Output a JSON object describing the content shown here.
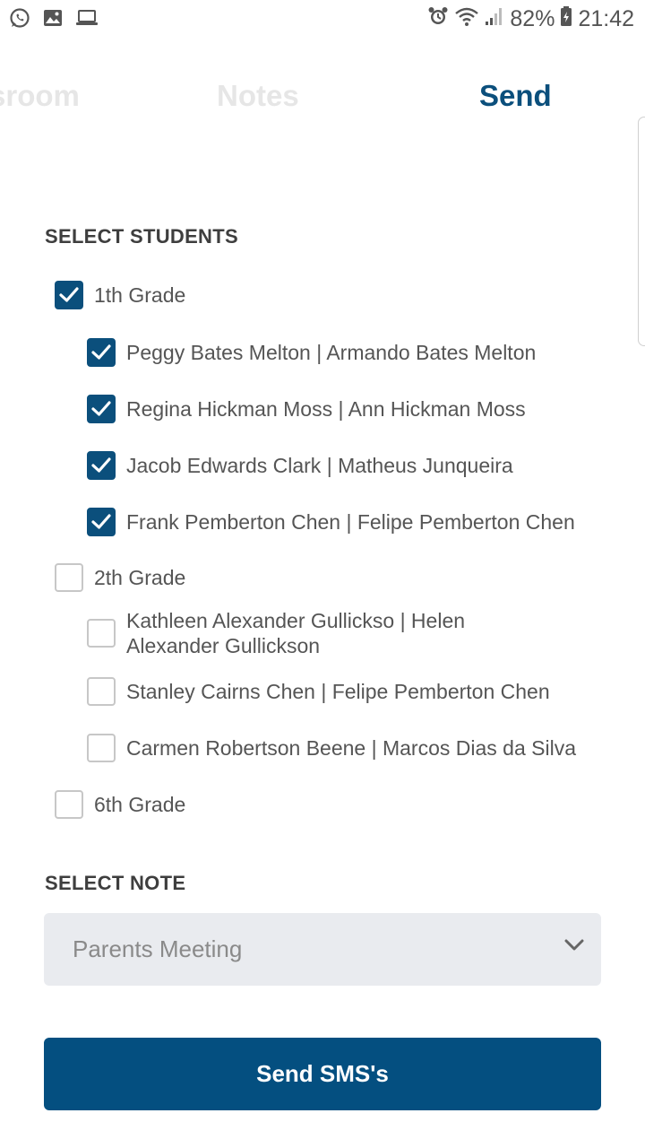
{
  "status_bar": {
    "left_icons": [
      "whatsapp-icon",
      "image-icon",
      "laptop-icon"
    ],
    "battery_percent": "82%",
    "time": "21:42"
  },
  "tabs": [
    {
      "label": "Classroom",
      "visible_text": "sroom",
      "active": false
    },
    {
      "label": "Notes",
      "active": false
    },
    {
      "label": "Send",
      "active": true
    }
  ],
  "students_section": {
    "title": "SELECT STUDENTS",
    "groups": [
      {
        "label": "1th Grade",
        "checked": true,
        "students": [
          {
            "label": "Peggy Bates Melton | Armando Bates Melton",
            "checked": true
          },
          {
            "label": "Regina Hickman Moss | Ann Hickman Moss",
            "checked": true
          },
          {
            "label": "Jacob Edwards Clark | Matheus Junqueira",
            "checked": true
          },
          {
            "label": "Frank Pemberton Chen | Felipe Pemberton Chen",
            "checked": true
          }
        ]
      },
      {
        "label": "2th Grade",
        "checked": false,
        "students": [
          {
            "label_line1": "Kathleen Alexander Gullickso | Helen",
            "label_line2": "Alexander Gullickson",
            "checked": false
          },
          {
            "label": "Stanley Cairns Chen | Felipe Pemberton Chen",
            "checked": false
          },
          {
            "label": "Carmen Robertson Beene | Marcos Dias da Silva",
            "checked": false
          }
        ]
      },
      {
        "label": "6th Grade",
        "checked": false,
        "students": []
      }
    ]
  },
  "note_section": {
    "title": "SELECT NOTE",
    "selected": "Parents Meeting"
  },
  "send_button": {
    "label": "Send SMS's"
  },
  "colors": {
    "accent": "#0b4f7c",
    "button": "#044f80",
    "select_bg": "#e9ebef"
  }
}
